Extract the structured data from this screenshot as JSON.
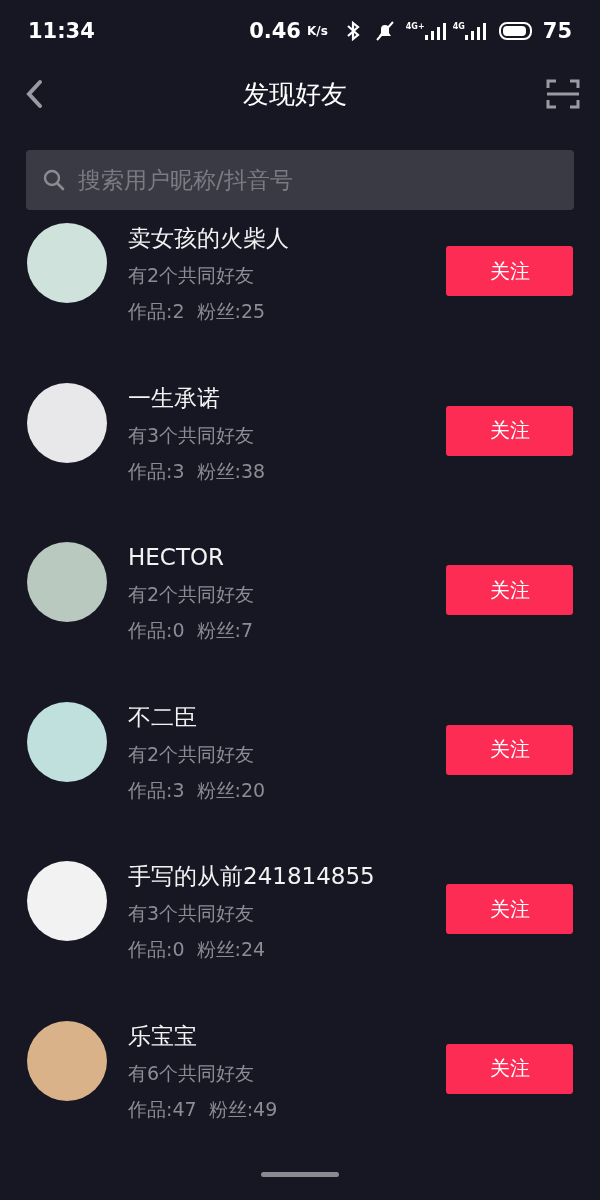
{
  "status_bar": {
    "time": "11:34",
    "speed": "0.46",
    "speed_unit": "K/s",
    "networks": [
      "4G+",
      "4G"
    ],
    "battery": "75"
  },
  "header": {
    "title": "发现好友"
  },
  "search": {
    "placeholder": "搜索用户昵称/抖音号"
  },
  "users": [
    {
      "name": "卖女孩的火柴人",
      "mutual": "有2个共同好友",
      "stats": "作品:2  粉丝:25",
      "button": "关注"
    },
    {
      "name": "一生承诺",
      "mutual": "有3个共同好友",
      "stats": "作品:3  粉丝:38",
      "button": "关注"
    },
    {
      "name": "HECTOR",
      "mutual": "有2个共同好友",
      "stats": "作品:0  粉丝:7",
      "button": "关注"
    },
    {
      "name": "不二臣",
      "mutual": "有2个共同好友",
      "stats": "作品:3  粉丝:20",
      "button": "关注"
    },
    {
      "name": "手写的从前241814855",
      "mutual": "有3个共同好友",
      "stats": "作品:0  粉丝:24",
      "button": "关注"
    },
    {
      "name": "乐宝宝",
      "mutual": "有6个共同好友",
      "stats": "作品:47  粉丝:49",
      "button": "关注"
    }
  ]
}
